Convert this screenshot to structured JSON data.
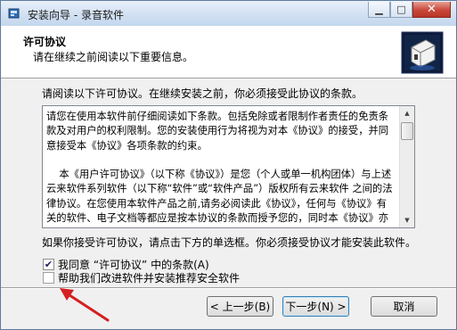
{
  "window": {
    "title": "安装向导 - 录音软件",
    "minimize_glyph": "▁",
    "maximize_glyph": "□",
    "close_glyph": "✕"
  },
  "header": {
    "title": "许可协议",
    "subtitle": "请在继续之前阅读以下重要信息。"
  },
  "body": {
    "instruction": "请阅读以下许可协议。在继续安装之前，你必须接受此协议的条款。",
    "license_text": "请您在使用本软件前仔细阅读如下条款。包括免除或者限制作者责任的免责条款及对用户的权利限制。您的安装使用行为将视为对本《协议》的接受，并同意接受本《协议》各项条款的约束。\n\n    本《用户许可协议》（以下称《协议》）是您（个人或单一机构团体）与上述 云来软件系列软件（以下称“软件”或“软件产品”）版权所有云来软件 之间的法律协议。在您使用本软件产品之前,请务必阅读此《协议》，任何与《协议》有关的软件、电子文档等都应是按本协议的条款而授予您的，同时本《协议》亦适用于任何有关本软件产品的后期发行和升级。",
    "agreement_hint": "如果你接受许可协议，请点击下方的单选框。你必须接受协议才能安装此软件。",
    "checkbox_agree": {
      "label": "我同意 “许可协议” 中的条款(A)",
      "checked": true
    },
    "checkbox_help": {
      "label": "帮助我们改进软件并安装推荐安全软件",
      "checked": false
    }
  },
  "buttons": {
    "back": "< 上一步(B)",
    "next": "下一步(N) >",
    "cancel": "取消"
  },
  "colors": {
    "annotation_arrow": "#d42020",
    "titlebar": "#c3d7ee"
  }
}
